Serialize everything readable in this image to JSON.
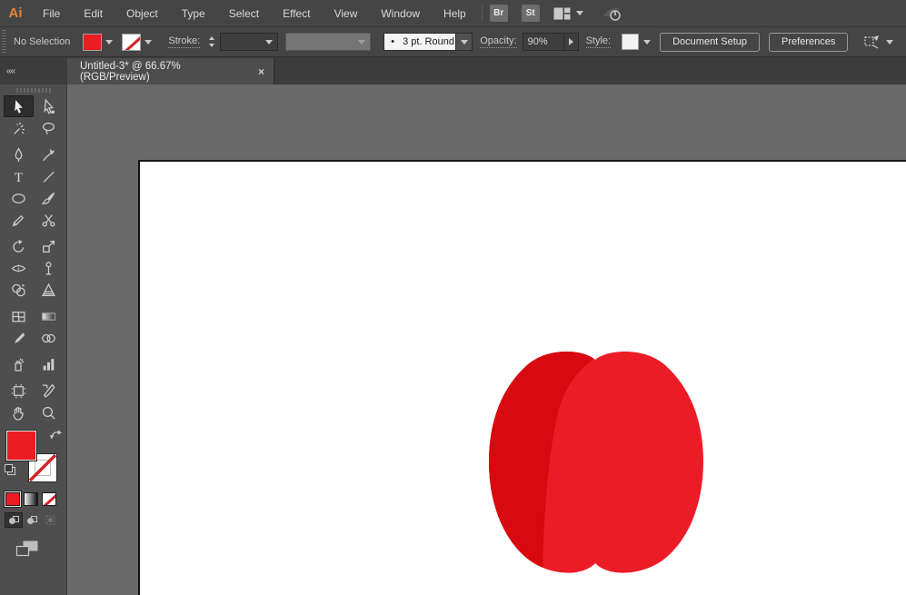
{
  "app": {
    "logo": "Ai"
  },
  "menubar": {
    "items": [
      "File",
      "Edit",
      "Object",
      "Type",
      "Select",
      "Effect",
      "View",
      "Window",
      "Help"
    ],
    "bridge_button": "Br",
    "style_panel_button": "St"
  },
  "control_bar": {
    "selection_status": "No Selection",
    "stroke_label": "Stroke:",
    "brush_bullet": "•",
    "brush_definition": "3 pt. Round",
    "opacity_label": "Opacity:",
    "opacity_value": "90%",
    "style_label": "Style:",
    "document_setup_button": "Document Setup",
    "preferences_button": "Preferences"
  },
  "document_tab": {
    "title": "Untitled-3* @ 66.67% (RGB/Preview)",
    "close": "×"
  },
  "toolbar": {
    "collapse_glyph": "«",
    "active_tool": "selection",
    "tools": [
      "selection",
      "direct-selection",
      "magic-wand",
      "lasso",
      "pen",
      "curvature-pen",
      "type",
      "line-segment",
      "ellipse",
      "paintbrush",
      "pencil",
      "scissors",
      "rotate",
      "scale",
      "width",
      "free-transform",
      "shape-builder",
      "perspective-grid",
      "mesh",
      "gradient",
      "eyedropper",
      "blend",
      "symbol-sprayer",
      "column-graph",
      "artboard",
      "slice",
      "hand",
      "zoom"
    ]
  },
  "colors": {
    "fill": "#EC1C24",
    "stroke": "none",
    "apple_light": "#EC1C26",
    "apple_dark": "#D8090F",
    "pasteboard": "#6A6A6A",
    "artboard": "#FFFFFF"
  }
}
